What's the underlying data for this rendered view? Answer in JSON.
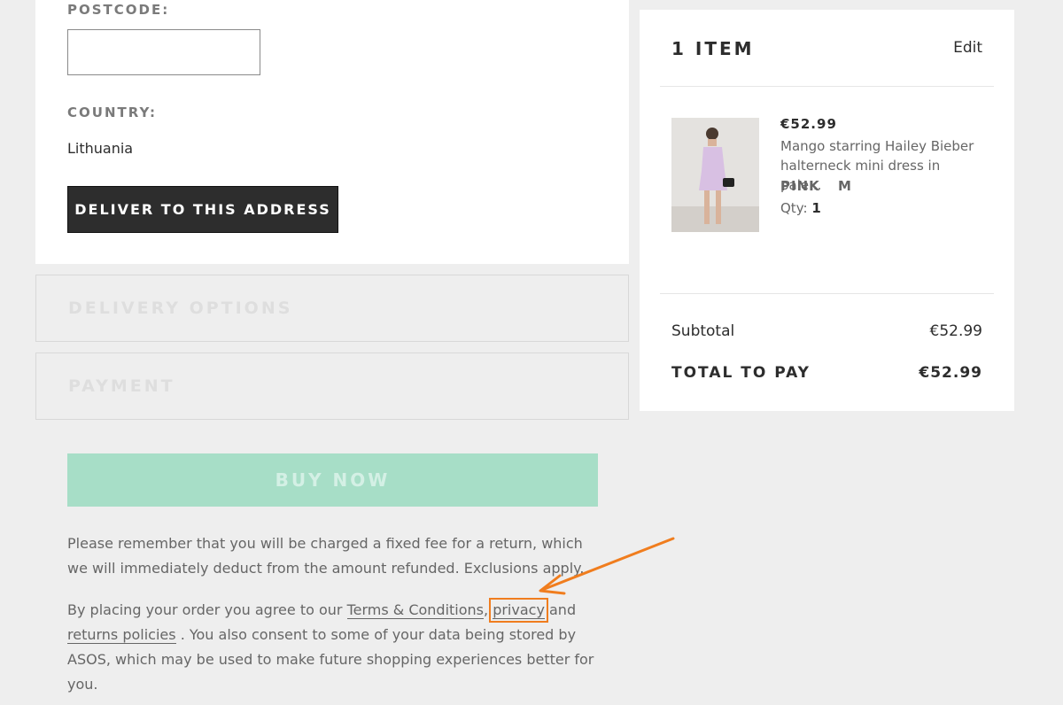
{
  "address": {
    "postcode_label": "POSTCODE:",
    "postcode_value": "",
    "country_label": "COUNTRY:",
    "country_value": "Lithuania",
    "deliver_button": "DELIVER TO THIS ADDRESS"
  },
  "sections": {
    "delivery_options": "DELIVERY OPTIONS",
    "payment": "PAYMENT"
  },
  "buy_now_button": "BUY NOW",
  "returns_note": "Please remember that you will be charged a fixed fee for a return, which we will immediately deduct from the amount refunded. Exclusions apply.",
  "consent": {
    "prefix": "By placing your order you agree to our ",
    "terms_link": "Terms & Conditions",
    "comma": ", ",
    "privacy_link": "privacy",
    "and": " and ",
    "returns_link": "returns policies",
    "suffix": " . You also consent to some of your data being stored by ASOS, which may be used to make future shopping experiences better for you."
  },
  "summary": {
    "item_count": "1 ITEM",
    "edit": "Edit",
    "product": {
      "price": "€52.99",
      "name": "Mango starring Hailey Bieber halterneck mini dress in pale...",
      "colour": "PINK",
      "size": "M",
      "qty_label": "Qty:",
      "qty_value": "1"
    },
    "subtotal_label": "Subtotal",
    "subtotal_value": "€52.99",
    "total_label": "TOTAL TO PAY",
    "total_value": "€52.99"
  },
  "colors": {
    "annotation": "#f07d1e",
    "buy_button": "#a7dec7",
    "dark_button": "#2d2d2d"
  }
}
